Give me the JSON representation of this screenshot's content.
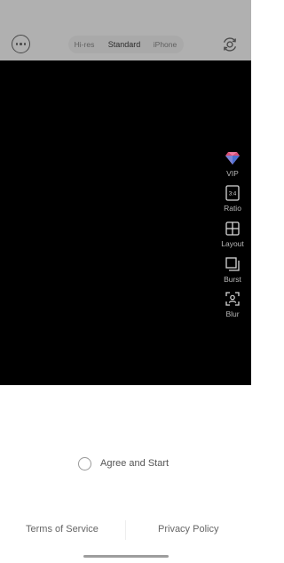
{
  "header": {
    "modes": [
      {
        "label": "Hi-res",
        "active": false
      },
      {
        "label": "Standard",
        "active": true
      },
      {
        "label": "iPhone",
        "active": false
      }
    ],
    "menu_icon": "more-horizontal-icon",
    "flip_icon": "flip-camera-icon"
  },
  "tools": [
    {
      "label": "VIP",
      "icon": "diamond-icon"
    },
    {
      "label": "Ratio",
      "icon": "ratio-3-4-icon",
      "icon_text": "3:4"
    },
    {
      "label": "Layout",
      "icon": "grid-layout-icon"
    },
    {
      "label": "Burst",
      "icon": "burst-stack-icon"
    },
    {
      "label": "Blur",
      "icon": "face-blur-icon"
    }
  ],
  "agreement": {
    "label": "Agree and Start",
    "checked": false
  },
  "footer": {
    "terms": "Terms of Service",
    "privacy": "Privacy Policy"
  },
  "colors": {
    "topbar": "#b0b0b0",
    "viewfinder": "#000000",
    "background": "#ffffff"
  }
}
